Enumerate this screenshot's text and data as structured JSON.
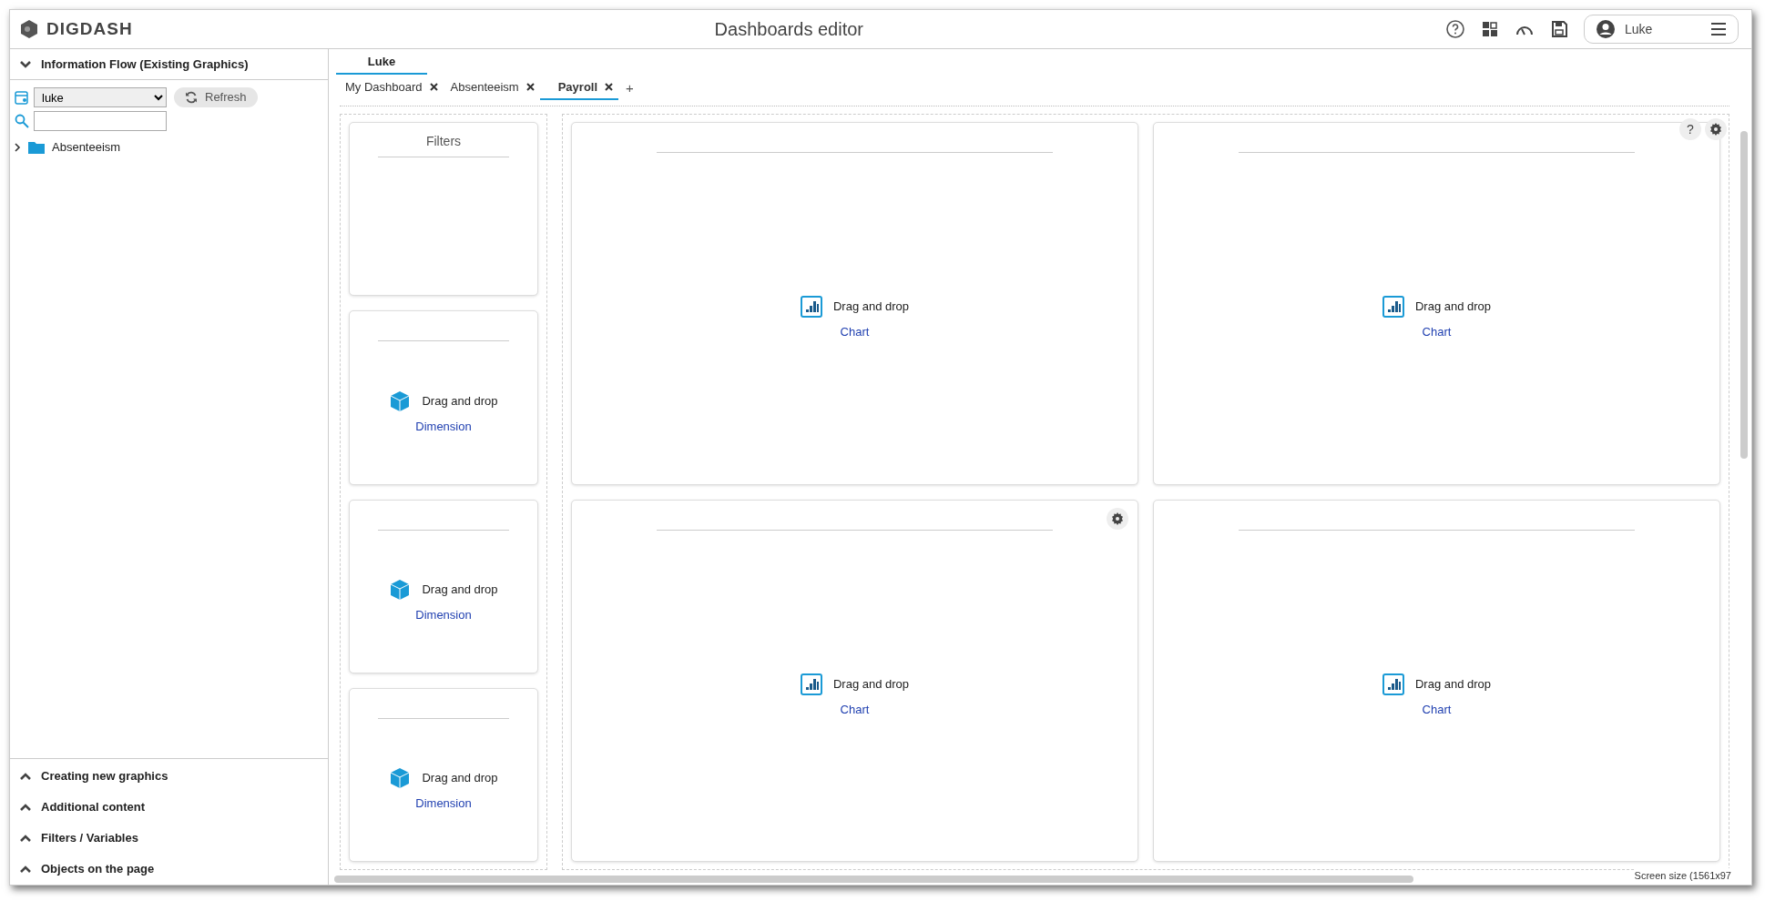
{
  "header": {
    "logo": "DIGDASH",
    "title": "Dashboards editor",
    "user": "Luke"
  },
  "left_panel": {
    "flow_section": {
      "label": "Information Flow (Existing Graphics)",
      "expanded": true
    },
    "source_select": {
      "value": "luke"
    },
    "refresh_button": "Refresh",
    "tree": [
      {
        "label": "Absenteeism",
        "expanded": false
      }
    ],
    "sections": [
      {
        "label": "Creating new graphics",
        "expanded": false
      },
      {
        "label": "Additional content",
        "expanded": false
      },
      {
        "label": "Filters / Variables",
        "expanded": false
      },
      {
        "label": "Objects on the page",
        "expanded": false
      }
    ]
  },
  "user_tabs": [
    {
      "label": "Luke",
      "selected": true
    }
  ],
  "page_tabs": [
    {
      "label": "My Dashboard",
      "selected": false
    },
    {
      "label": "Absenteeism",
      "selected": false
    },
    {
      "label": "Payroll",
      "selected": true
    }
  ],
  "add_tab": "+",
  "filter_column": [
    {
      "kind": "filters",
      "title": "Filters"
    },
    {
      "kind": "dimension",
      "drop_text": "Drag and drop",
      "drop_link": "Dimension"
    },
    {
      "kind": "dimension",
      "drop_text": "Drag and drop",
      "drop_link": "Dimension"
    },
    {
      "kind": "dimension",
      "drop_text": "Drag and drop",
      "drop_link": "Dimension"
    }
  ],
  "grid_help": "?",
  "chart_grid": [
    {
      "drop_text": "Drag and drop",
      "drop_link": "Chart",
      "settings": false
    },
    {
      "drop_text": "Drag and drop",
      "drop_link": "Chart",
      "settings": false
    },
    {
      "drop_text": "Drag and drop",
      "drop_link": "Chart",
      "settings": true
    },
    {
      "drop_text": "Drag and drop",
      "drop_link": "Chart",
      "settings": false
    }
  ],
  "screen_size": "Screen size (1561x97"
}
